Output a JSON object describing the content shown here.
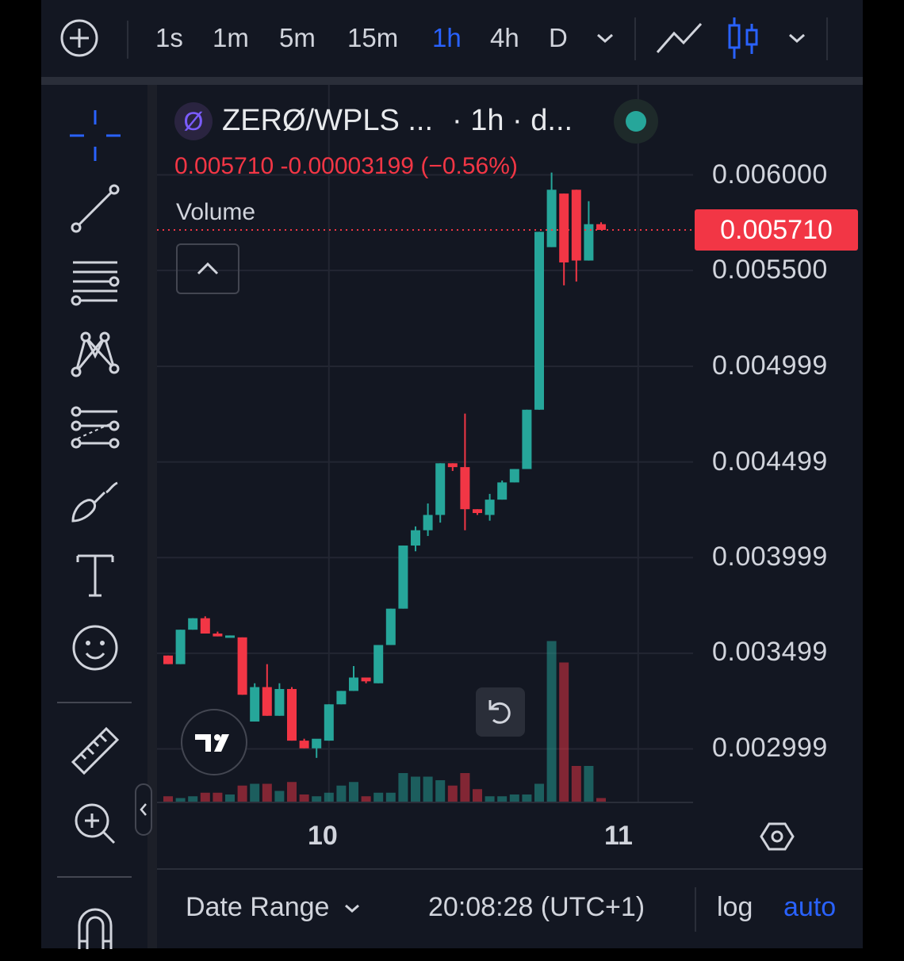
{
  "topbar": {
    "timeframes": [
      "1s",
      "1m",
      "5m",
      "15m",
      "1h",
      "4h",
      "D"
    ],
    "active_timeframe": "1h"
  },
  "legend": {
    "symbol_name": "ZERØ/WPLS ...",
    "symbol_meta": "· 1h · d...",
    "logo_glyph": "Ø",
    "last": "0.005710",
    "change": "-0.00003199",
    "change_pct": "(−0.56%)",
    "volume_label": "Volume"
  },
  "price_axis": {
    "labels": [
      "0.006000",
      "0.005500",
      "0.004999",
      "0.004499",
      "0.003999",
      "0.003499",
      "0.002999"
    ],
    "current_price": "0.005710"
  },
  "time_axis": {
    "labels": [
      "10",
      "11"
    ]
  },
  "bottombar": {
    "date_range": "Date Range",
    "clock": "20:08:28 (UTC+1)",
    "log": "log",
    "auto": "auto"
  },
  "colors": {
    "up": "#26a69a",
    "down": "#f23645",
    "accent": "#2962ff",
    "background": "#131722"
  },
  "toolbar_icons": [
    "crosshair-icon",
    "trend-line-icon",
    "fib-retracement-icon",
    "pattern-icon",
    "prediction-icon",
    "brush-icon",
    "text-icon",
    "emoji-icon",
    "ruler-icon",
    "zoom-in-icon",
    "magnet-icon"
  ],
  "chart_data": {
    "type": "candlestick",
    "interval": "1h",
    "y_scale": "linear",
    "ylim": [
      0.0027,
      0.0062
    ],
    "current_price": 0.00571,
    "candles": [
      {
        "o": 0.003485,
        "h": 0.003485,
        "l": 0.00344,
        "c": 0.00344
      },
      {
        "o": 0.00344,
        "h": 0.00362,
        "l": 0.00344,
        "c": 0.00362
      },
      {
        "o": 0.00362,
        "h": 0.00368,
        "l": 0.00362,
        "c": 0.00368
      },
      {
        "o": 0.00368,
        "h": 0.00369,
        "l": 0.0036,
        "c": 0.0036
      },
      {
        "o": 0.0036,
        "h": 0.00361,
        "l": 0.003585,
        "c": 0.003585
      },
      {
        "o": 0.003585,
        "h": 0.00359,
        "l": 0.00358,
        "c": 0.00359
      },
      {
        "o": 0.00358,
        "h": 0.00358,
        "l": 0.00328,
        "c": 0.00328
      },
      {
        "o": 0.00314,
        "h": 0.00334,
        "l": 0.00314,
        "c": 0.00332
      },
      {
        "o": 0.00332,
        "h": 0.00344,
        "l": 0.00317,
        "c": 0.00317
      },
      {
        "o": 0.00317,
        "h": 0.00334,
        "l": 0.00317,
        "c": 0.00331
      },
      {
        "o": 0.00331,
        "h": 0.00332,
        "l": 0.00304,
        "c": 0.00304
      },
      {
        "o": 0.00304,
        "h": 0.00305,
        "l": 0.003,
        "c": 0.003
      },
      {
        "o": 0.003,
        "h": 0.00304,
        "l": 0.00295,
        "c": 0.00305
      },
      {
        "o": 0.00304,
        "h": 0.00323,
        "l": 0.00304,
        "c": 0.00323
      },
      {
        "o": 0.00323,
        "h": 0.0033,
        "l": 0.00323,
        "c": 0.0033
      },
      {
        "o": 0.0033,
        "h": 0.00343,
        "l": 0.0033,
        "c": 0.00337
      },
      {
        "o": 0.00337,
        "h": 0.00337,
        "l": 0.00334,
        "c": 0.00335
      },
      {
        "o": 0.00334,
        "h": 0.00354,
        "l": 0.00334,
        "c": 0.00354
      },
      {
        "o": 0.00354,
        "h": 0.00373,
        "l": 0.00354,
        "c": 0.00373
      },
      {
        "o": 0.00373,
        "h": 0.00406,
        "l": 0.00373,
        "c": 0.00406
      },
      {
        "o": 0.00406,
        "h": 0.00416,
        "l": 0.00403,
        "c": 0.00414
      },
      {
        "o": 0.00414,
        "h": 0.00428,
        "l": 0.00411,
        "c": 0.00422
      },
      {
        "o": 0.00422,
        "h": 0.00449,
        "l": 0.00418,
        "c": 0.00449
      },
      {
        "o": 0.00449,
        "h": 0.00449,
        "l": 0.00445,
        "c": 0.00447
      },
      {
        "o": 0.00447,
        "h": 0.00475,
        "l": 0.00414,
        "c": 0.00425
      },
      {
        "o": 0.00425,
        "h": 0.00425,
        "l": 0.00422,
        "c": 0.00423
      },
      {
        "o": 0.00422,
        "h": 0.00433,
        "l": 0.00419,
        "c": 0.0043
      },
      {
        "o": 0.0043,
        "h": 0.0044,
        "l": 0.0043,
        "c": 0.00439
      },
      {
        "o": 0.00439,
        "h": 0.00446,
        "l": 0.00439,
        "c": 0.00446
      },
      {
        "o": 0.00446,
        "h": 0.00477,
        "l": 0.00446,
        "c": 0.00477
      },
      {
        "o": 0.00477,
        "h": 0.0057,
        "l": 0.00477,
        "c": 0.0057
      },
      {
        "o": 0.00562,
        "h": 0.00601,
        "l": 0.00562,
        "c": 0.00592
      },
      {
        "o": 0.0059,
        "h": 0.0059,
        "l": 0.00542,
        "c": 0.00554
      },
      {
        "o": 0.00592,
        "h": 0.00592,
        "l": 0.00544,
        "c": 0.00555
      },
      {
        "o": 0.00555,
        "h": 0.00586,
        "l": 0.00555,
        "c": 0.00574
      },
      {
        "o": 0.00574,
        "h": 0.00575,
        "l": 0.00571,
        "c": 0.00571
      }
    ],
    "volume": [
      3,
      2,
      3,
      5,
      5,
      4,
      9,
      10,
      10,
      6,
      11,
      4,
      3,
      5,
      9,
      11,
      3,
      5,
      5,
      16,
      14,
      14,
      12,
      9,
      16,
      7,
      3,
      3,
      4,
      4,
      10,
      90,
      78,
      20,
      20,
      2
    ],
    "time_labels": [
      {
        "label": "10",
        "index": 13
      },
      {
        "label": "11",
        "index": 38
      }
    ]
  }
}
